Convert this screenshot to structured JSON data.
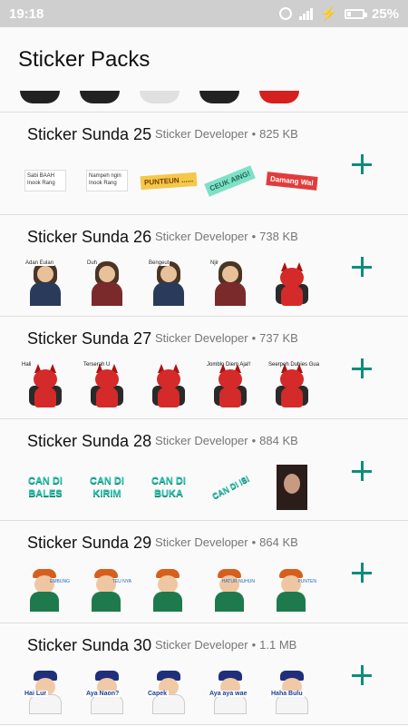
{
  "status_bar": {
    "time": "19:18",
    "battery_percent": "25%",
    "battery_level": 0.25,
    "icons": [
      "alarm-icon",
      "signal-icon",
      "charging-icon",
      "battery-icon"
    ]
  },
  "app_bar": {
    "title": "Sticker Packs"
  },
  "colors": {
    "accent": "#0f8c7c",
    "status_bar": "#cfcfcf",
    "divider": "#dddddd"
  },
  "packs": [
    {
      "name": "Sticker Sunda 25",
      "publisher": "Sticker Developer",
      "size": "825 KB",
      "stickers": [
        {
          "kind": "note",
          "text": "Sabi BAAH Inook Rang"
        },
        {
          "kind": "note",
          "text": "Nampeh ngin Inook Rang"
        },
        {
          "kind": "banner-yellow",
          "text": "PUNTEUN ......"
        },
        {
          "kind": "banner-teal",
          "text": "CEUK AING!"
        },
        {
          "kind": "banner-red",
          "text": "Damang Wal"
        }
      ]
    },
    {
      "name": "Sticker Sunda 26",
      "publisher": "Sticker Developer",
      "size": "738 KB",
      "stickers": [
        {
          "kind": "person",
          "text": "Adan Eulan"
        },
        {
          "kind": "person",
          "text": "Duh"
        },
        {
          "kind": "person",
          "text": "Bengeut"
        },
        {
          "kind": "person",
          "text": "Njir"
        },
        {
          "kind": "devil",
          "text": ""
        }
      ]
    },
    {
      "name": "Sticker Sunda 27",
      "publisher": "Sticker Developer",
      "size": "737 KB",
      "stickers": [
        {
          "kind": "devil",
          "text": "Hali"
        },
        {
          "kind": "devil",
          "text": "Terserah U"
        },
        {
          "kind": "devil",
          "text": ""
        },
        {
          "kind": "devil",
          "text": "Jomblo Diem Aja!!"
        },
        {
          "kind": "devil",
          "text": "Seerpeh Dubies Gua"
        }
      ]
    },
    {
      "name": "Sticker Sunda 28",
      "publisher": "Sticker Developer",
      "size": "884 KB",
      "stickers": [
        {
          "kind": "word",
          "text": "CAN DI BALES"
        },
        {
          "kind": "word",
          "text": "CAN DI KIRIM"
        },
        {
          "kind": "word",
          "text": "CAN DI BUKA"
        },
        {
          "kind": "word-rot",
          "text": "CAN DI ISI"
        },
        {
          "kind": "photo",
          "text": ""
        }
      ]
    },
    {
      "name": "Sticker Sunda 29",
      "publisher": "Sticker Developer",
      "size": "864 KB",
      "stickers": [
        {
          "kind": "boy",
          "text": "EMBUNG"
        },
        {
          "kind": "boy",
          "text": "TEU NYA"
        },
        {
          "kind": "boy",
          "text": ""
        },
        {
          "kind": "boy",
          "text": "HATUR NUHUN"
        },
        {
          "kind": "boy",
          "text": "PUNTEN"
        }
      ]
    },
    {
      "name": "Sticker Sunda 30",
      "publisher": "Sticker Developer",
      "size": "1.1 MB",
      "stickers": [
        {
          "kind": "sunda",
          "text": "Hai Lur"
        },
        {
          "kind": "sunda",
          "text": "Aya Naon?"
        },
        {
          "kind": "sunda",
          "text": "Capek"
        },
        {
          "kind": "sunda",
          "text": "Aya aya wae"
        },
        {
          "kind": "sunda",
          "text": "Haha Bulu"
        }
      ]
    }
  ]
}
